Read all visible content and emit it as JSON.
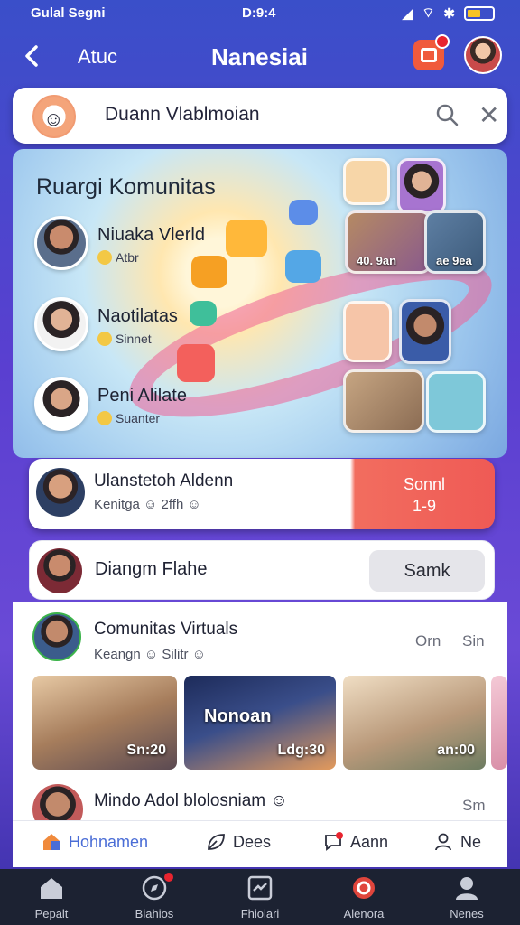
{
  "status_bar": {
    "carrier": "Gulal Segni",
    "time": "D:9:4",
    "battery_color": "#f7c325"
  },
  "header": {
    "back_label": "Atuc",
    "title": "Nanesiai",
    "notification_icon": "bell-icon",
    "avatar_icon": "profile-avatar"
  },
  "search": {
    "value": "Duann Vlablmoian",
    "search_icon": "search-icon",
    "close_icon": "close-icon"
  },
  "hero": {
    "title": "Ruargi Komunitas",
    "members": [
      {
        "name": "Niuaka Vlerld",
        "status": "Atbr"
      },
      {
        "name": "Naotilatas",
        "status": "Sinnet"
      },
      {
        "name": "Peni Alilate",
        "status": "Suanter"
      }
    ],
    "video_tiles": [
      "40. 9an",
      "ae 9ea"
    ]
  },
  "featured_card": {
    "name": "Ulanstetoh Aldenn",
    "status": "Kenitga",
    "status_extra": "2ffh",
    "action_line1": "Sonnl",
    "action_line2": "1-9"
  },
  "suggest_card": {
    "name": "Diangm Flahe",
    "button_label": "Samk"
  },
  "feed_item": {
    "name": "Comunitas Virtuals",
    "status": "Keangn",
    "status_extra": "Silitr",
    "meta1": "Orn",
    "meta2": "Sin"
  },
  "thumbnails": [
    {
      "caption": "Sn:20",
      "overlay": ""
    },
    {
      "caption": "Ldg:30",
      "overlay": "Nonoan"
    },
    {
      "caption": "an:00",
      "overlay": ""
    }
  ],
  "feed_item2": {
    "name": "Mindo Adol blolosniam",
    "meta": "Sm"
  },
  "tabs": [
    {
      "label": "Hohnamen",
      "icon": "home-icon"
    },
    {
      "label": "Dees",
      "icon": "leaf-icon"
    },
    {
      "label": "Aann",
      "icon": "chat-icon"
    },
    {
      "label": "Ne",
      "icon": "user-icon"
    }
  ],
  "bottom_nav": [
    {
      "label": "Pepalt",
      "icon": "home-icon"
    },
    {
      "label": "Biahios",
      "icon": "compass-icon"
    },
    {
      "label": "Fhiolari",
      "icon": "image-icon"
    },
    {
      "label": "Alenora",
      "icon": "search-icon"
    },
    {
      "label": "Nenes",
      "icon": "profile-icon"
    }
  ],
  "accent_colors": {
    "primary": "#4a6dd6",
    "action": "#ef5a55",
    "badge": "#e8242f"
  }
}
